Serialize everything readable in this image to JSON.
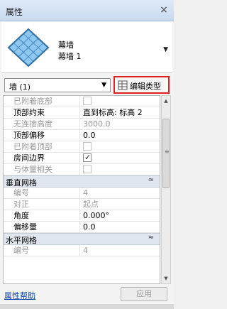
{
  "panel": {
    "title": "属性",
    "close_glyph": "×"
  },
  "type_selector": {
    "family": "幕墙",
    "type_name": "幕墙 1",
    "thumbnail_icon": "curtain-wall-thumbnail-icon"
  },
  "instance_filter": {
    "value": "墙 (1)"
  },
  "edit_type_button": {
    "label": "编辑类型",
    "icon": "edit-type-icon"
  },
  "properties": [
    {
      "kind": "row",
      "name": "已附着底部",
      "value_type": "checkbox",
      "checked": false,
      "disabled": true
    },
    {
      "kind": "row",
      "name": "顶部约束",
      "value": "直到标高: 标高 2",
      "disabled": false
    },
    {
      "kind": "row",
      "name": "无连接高度",
      "value": "3000.0",
      "disabled": true
    },
    {
      "kind": "row",
      "name": "顶部偏移",
      "value": "0.0",
      "disabled": false
    },
    {
      "kind": "row",
      "name": "已附着顶部",
      "value_type": "checkbox",
      "checked": false,
      "disabled": true
    },
    {
      "kind": "row",
      "name": "房间边界",
      "value_type": "checkbox",
      "checked": true,
      "disabled": false
    },
    {
      "kind": "row",
      "name": "与体量相关",
      "value_type": "checkbox",
      "checked": false,
      "disabled": true
    },
    {
      "kind": "group",
      "name": "垂直网格",
      "collapse_glyph": "≈"
    },
    {
      "kind": "row",
      "name": "编号",
      "value": "4",
      "disabled": true
    },
    {
      "kind": "row",
      "name": "对正",
      "value": "起点",
      "disabled": true
    },
    {
      "kind": "row",
      "name": "角度",
      "value": "0.000°",
      "disabled": false
    },
    {
      "kind": "row",
      "name": "偏移量",
      "value": "0.0",
      "disabled": false
    },
    {
      "kind": "group",
      "name": "水平网格",
      "collapse_glyph": "≈"
    },
    {
      "kind": "row",
      "name": "编号",
      "value": "4",
      "disabled": true
    }
  ],
  "footer": {
    "help_label": "属性帮助",
    "apply_label": "应用"
  },
  "colors": {
    "highlight_border": "#e02020",
    "group_bg": "#dfe6ee",
    "link": "#0645ad"
  }
}
